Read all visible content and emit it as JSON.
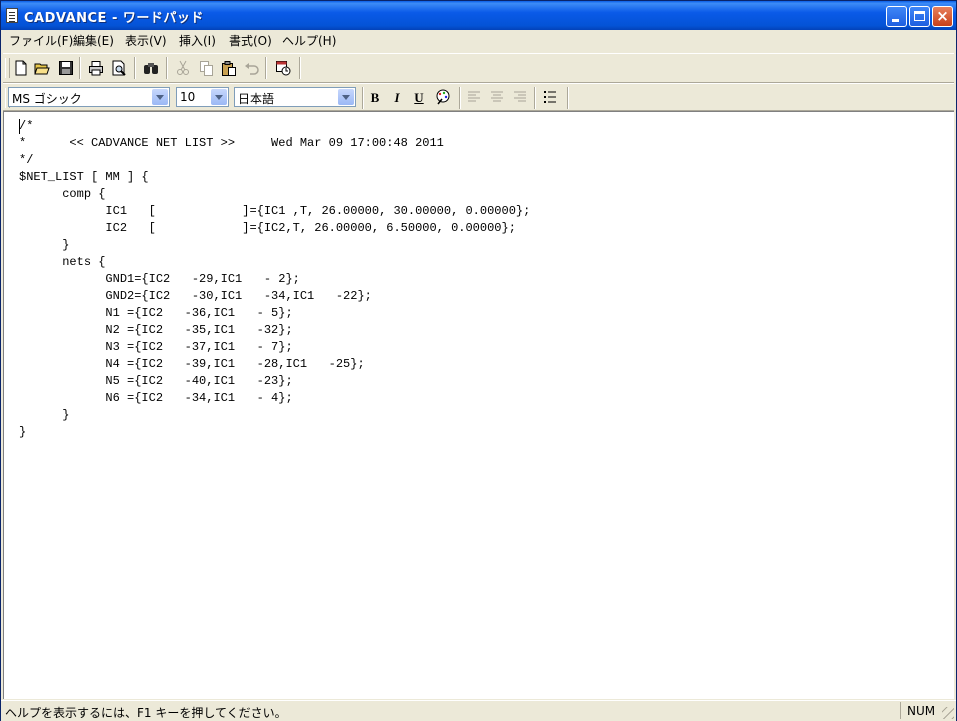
{
  "window": {
    "title": "CADVANCE - ワードパッド",
    "close_glyph": "×"
  },
  "menu": {
    "items": [
      "ファイル(F)",
      "編集(E)",
      "表示(V)",
      "挿入(I)",
      "書式(O)",
      "ヘルプ(H)"
    ]
  },
  "toolbar": {
    "icons": [
      "new-document-icon",
      "open-folder-icon",
      "save-icon",
      "print-icon",
      "print-preview-icon",
      "find-icon",
      "cut-icon",
      "copy-icon",
      "paste-icon",
      "undo-icon",
      "insert-date-time-icon"
    ]
  },
  "format": {
    "font_name": "MS ゴシック",
    "font_size": "10",
    "script": "日本語",
    "bold": "B",
    "italic": "I",
    "underline": "U"
  },
  "document": {
    "text": "/*\n*      << CADVANCE NET LIST >>     Wed Mar 09 17:00:48 2011\n*/\n$NET_LIST [ MM ] {\n\tcomp {\n\t\tIC1   [            ]={IC1 ,T, 26.00000, 30.00000, 0.00000};\n\t\tIC2   [            ]={IC2,T, 26.00000, 6.50000, 0.00000};\n\t}\n\tnets {\n\t\tGND1={IC2   -29,IC1   - 2};\n\t\tGND2={IC2   -30,IC1   -34,IC1   -22};\n\t\tN1 ={IC2   -36,IC1   - 5};\n\t\tN2 ={IC2   -35,IC1   -32};\n\t\tN3 ={IC2   -37,IC1   - 7};\n\t\tN4 ={IC2   -39,IC1   -28,IC1   -25};\n\t\tN5 ={IC2   -40,IC1   -23};\n\t\tN6 ={IC2   -34,IC1   - 4};\n\t}\n}"
  },
  "status": {
    "help_text": "ヘルプを表示するには、F1 キーを押してください。",
    "num_lock": "NUM"
  },
  "colors": {
    "titlebar": "#0a5ae8",
    "window_face": "#ece9d8",
    "close_button": "#c8401a"
  }
}
